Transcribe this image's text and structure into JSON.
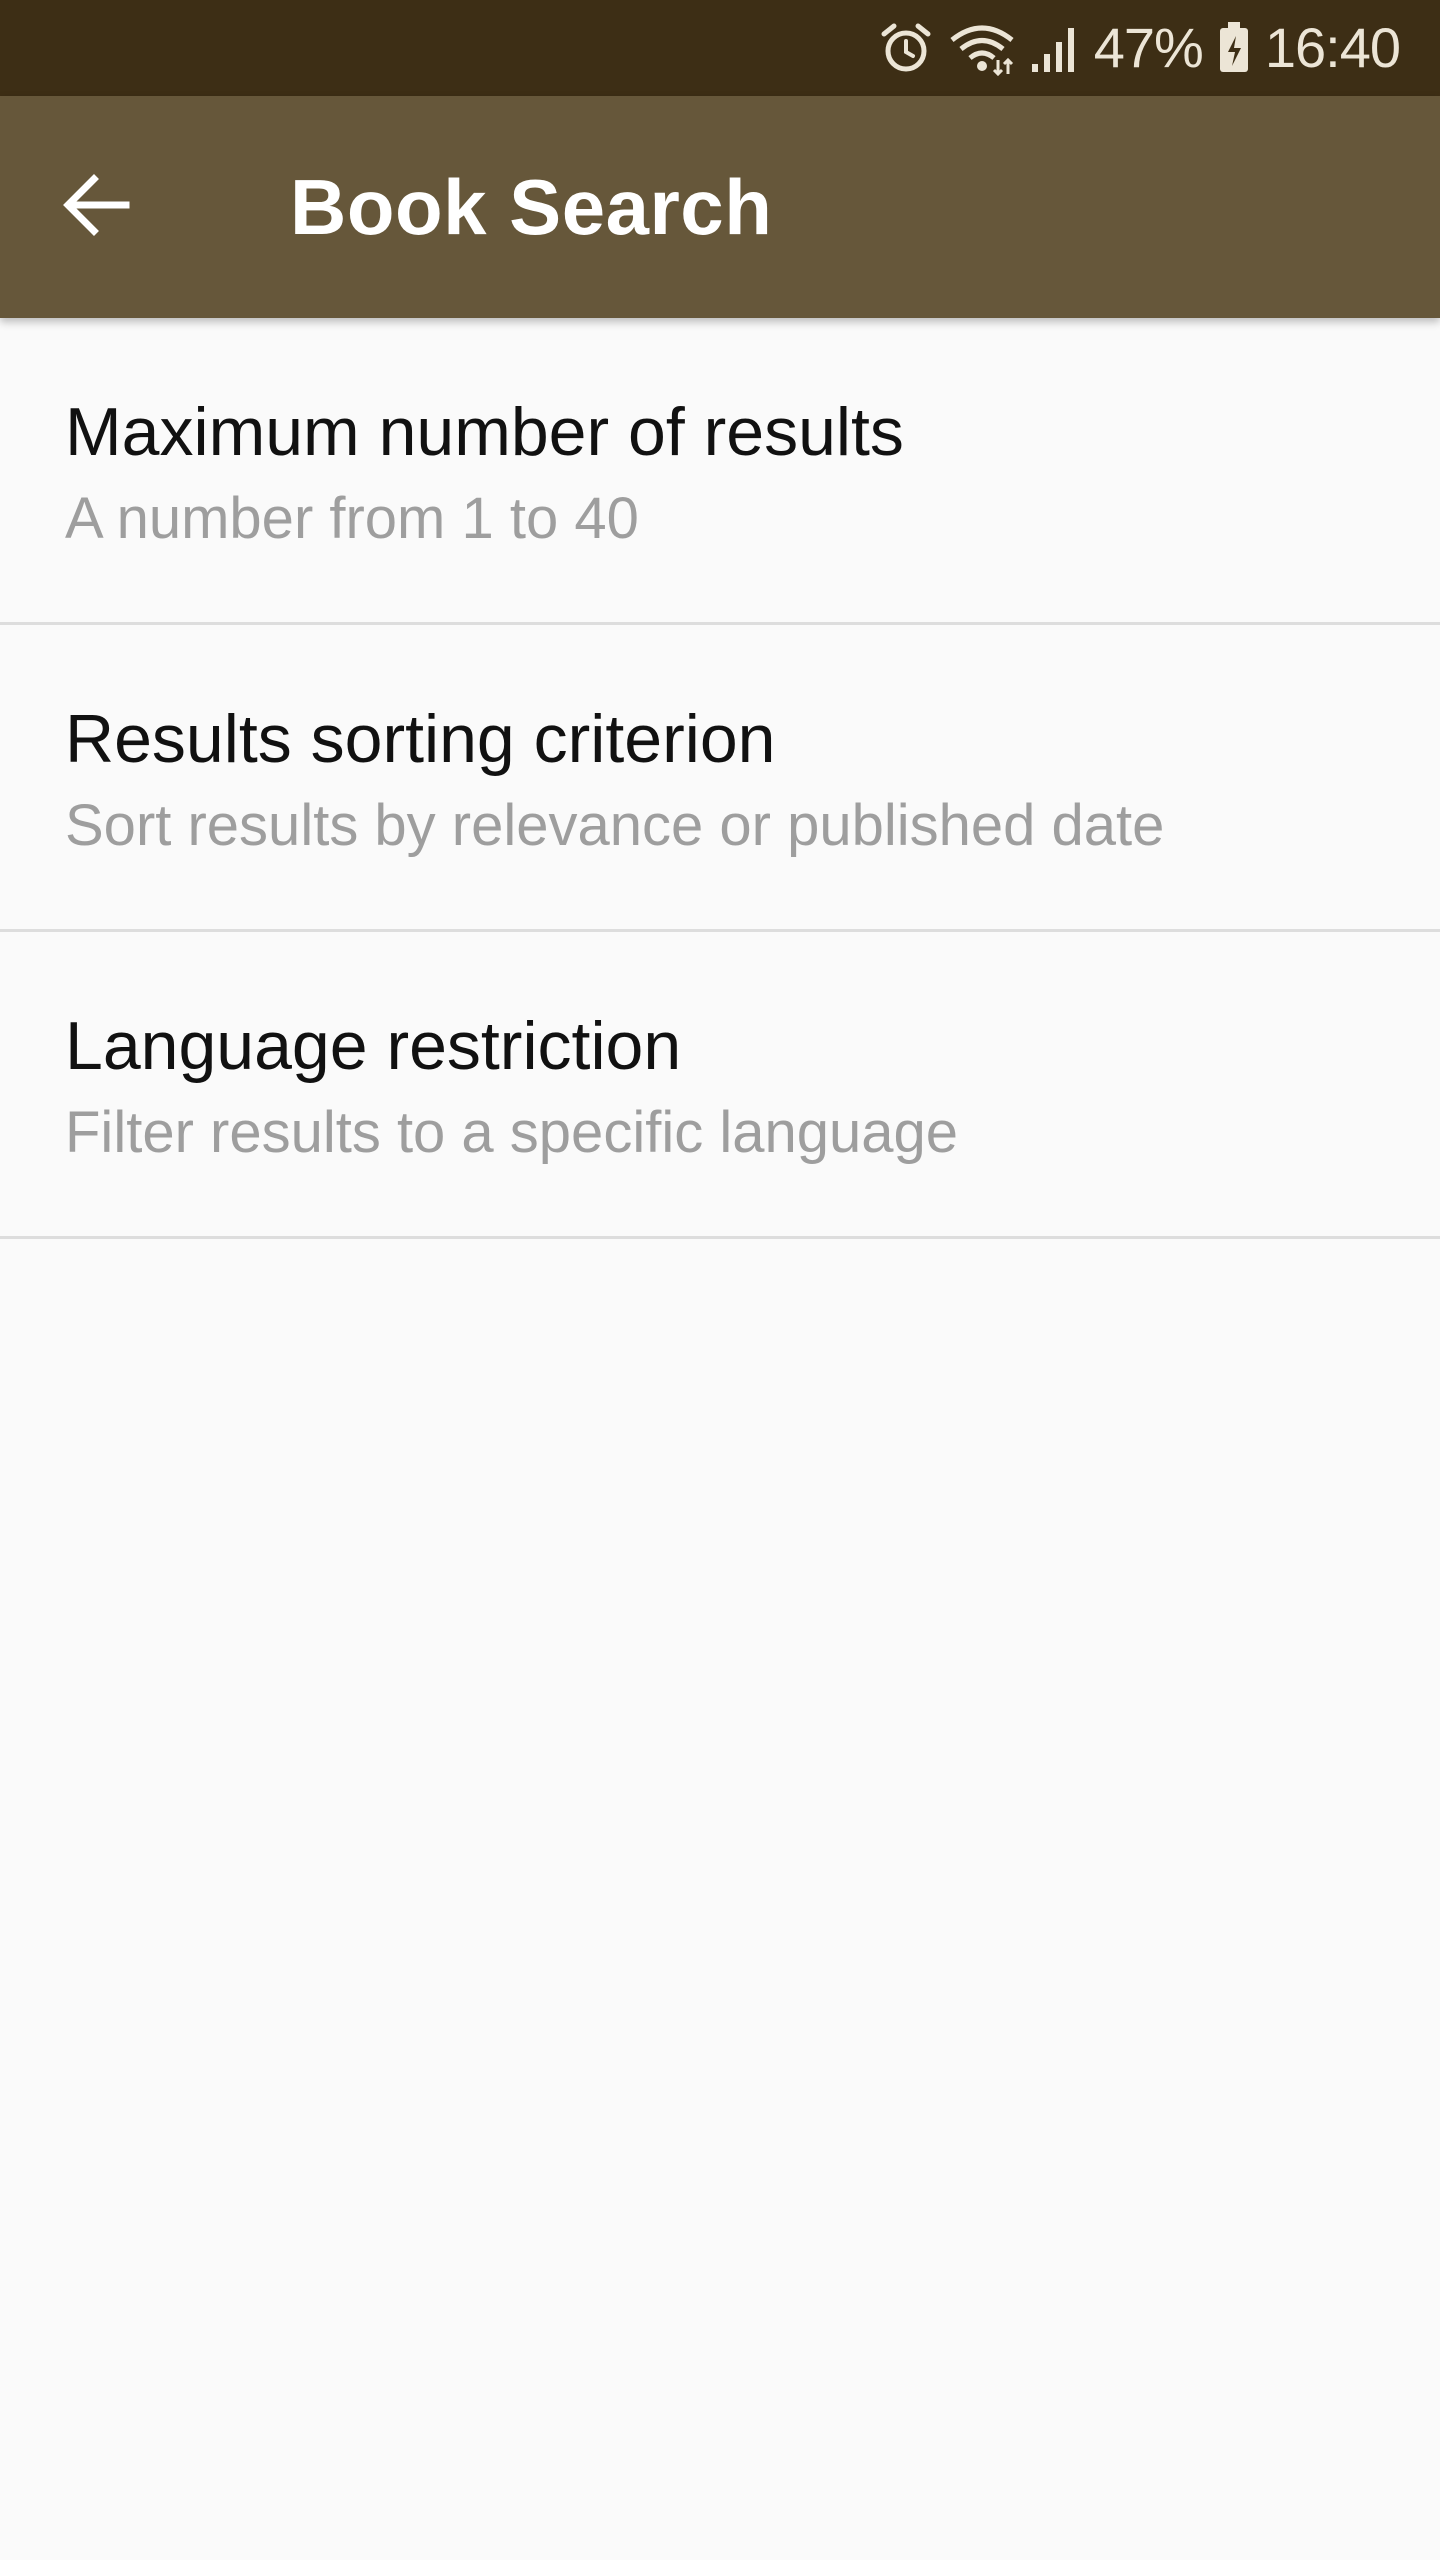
{
  "status_bar": {
    "battery_percent": "47%",
    "time": "16:40",
    "icons": [
      "alarm-icon",
      "wifi-icon",
      "signal-icon",
      "battery-icon"
    ]
  },
  "app_bar": {
    "back_icon": "arrow-left-icon",
    "title": "Book Search"
  },
  "preferences": [
    {
      "title": "Maximum number of results",
      "summary": "A number from 1 to 40"
    },
    {
      "title": "Results sorting criterion",
      "summary": "Sort results by relevance or published date"
    },
    {
      "title": "Language restriction",
      "summary": "Filter results to a specific language"
    }
  ],
  "colors": {
    "status_bar": "#3d2e15",
    "app_bar": "#66573a",
    "background": "#fafafa",
    "title_text": "#111111",
    "summary_text": "#9e9e9e",
    "divider": "#dddddd"
  }
}
